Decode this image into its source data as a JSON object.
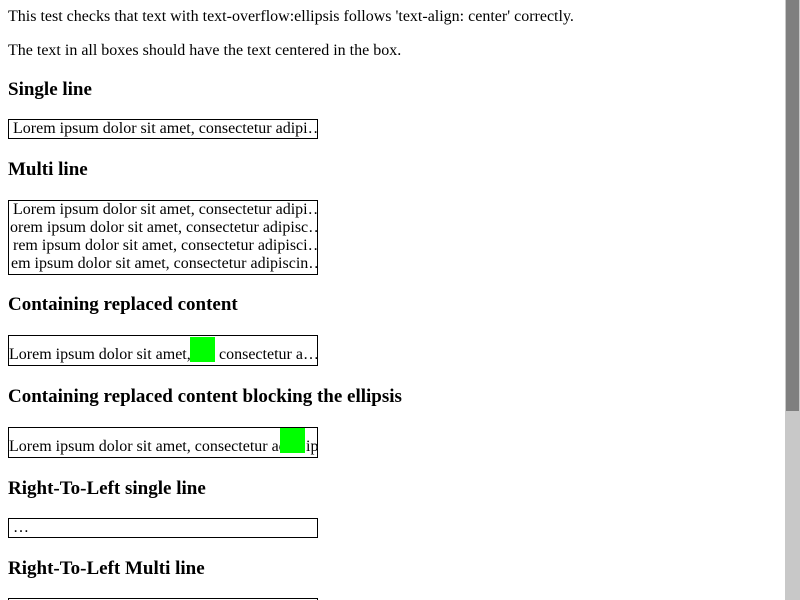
{
  "intro": {
    "line1": "This test checks that text with text-overflow:ellipsis follows 'text-align: center' correctly.",
    "line2": "The text in all boxes should have the text centered in the box."
  },
  "sections": {
    "single": {
      "heading": "Single line",
      "line": "Lorem ipsum dolor sit amet, consectetur adipi…"
    },
    "multi": {
      "heading": "Multi line",
      "lines": [
        "Lorem ipsum dolor sit amet, consectetur adipi…",
        "orem ipsum dolor sit amet, consectetur adipisc…",
        "rem ipsum dolor sit amet, consectetur adipisci…",
        "em ipsum dolor sit amet, consectetur adipiscin…"
      ]
    },
    "replaced": {
      "heading": "Containing replaced content",
      "before": "Lorem ipsum dolor sit amet,",
      "after": "consectetur a…"
    },
    "blocking": {
      "heading": "Containing replaced content blocking the ellipsis",
      "before": "Lorem ipsum dolor sit amet, consectetur ad",
      "after": "ip"
    },
    "rtl_single": {
      "heading": "Right-To-Left single line",
      "line": "…"
    },
    "rtl_multi": {
      "heading": "Right-To-Left Multi line"
    }
  },
  "colors": {
    "replaced_block": "#00ff00"
  }
}
